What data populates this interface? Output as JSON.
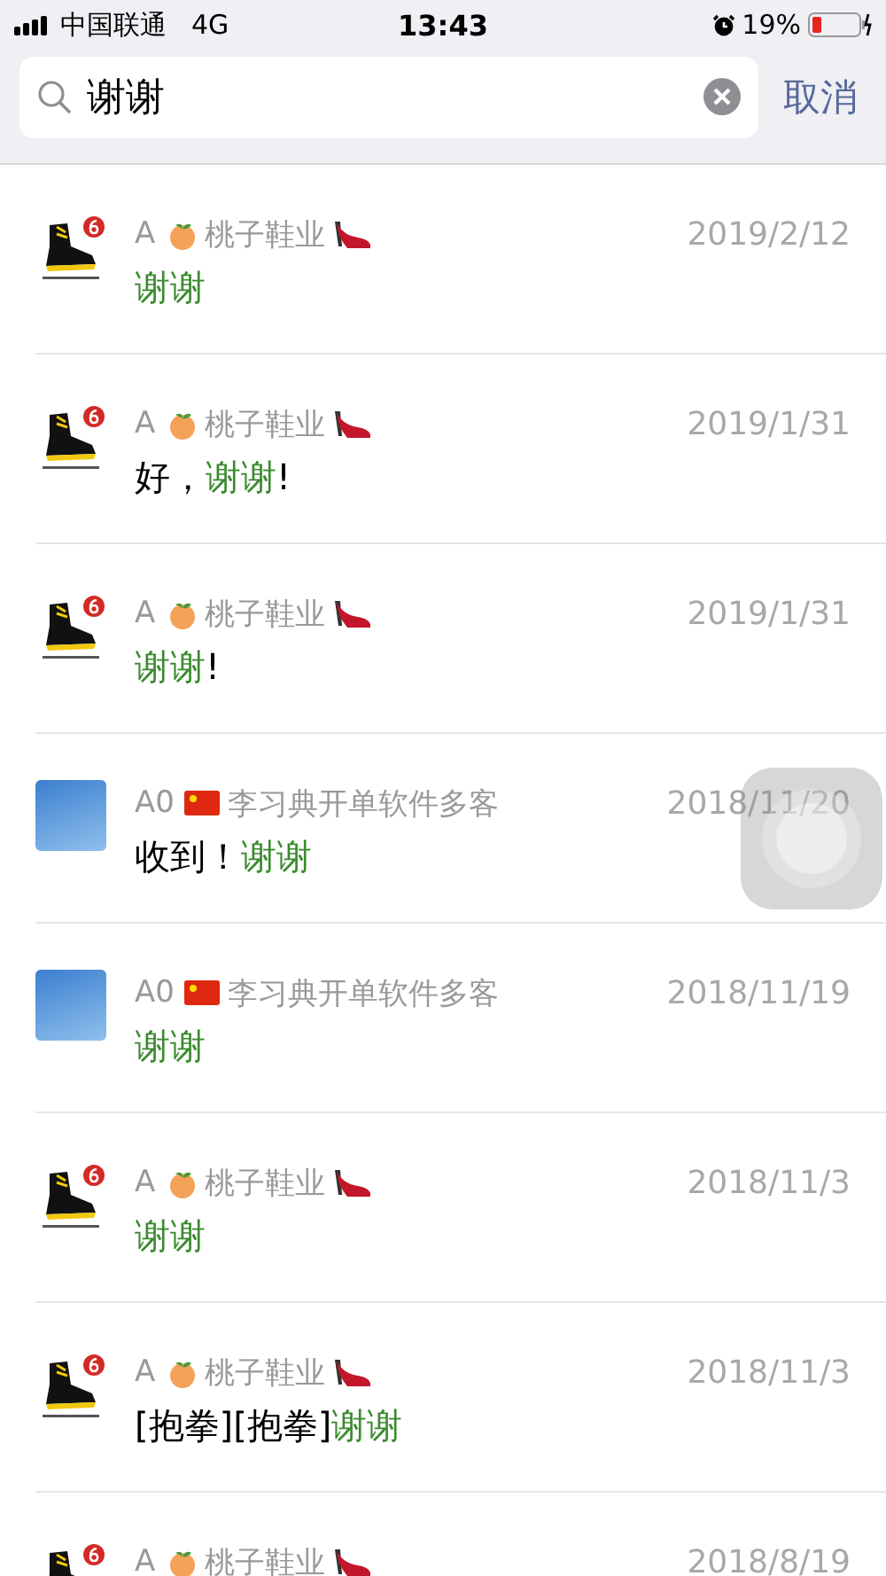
{
  "status_bar": {
    "carrier": "中国联通",
    "network": "4G",
    "time": "13:43",
    "battery_text": "19%"
  },
  "search": {
    "value": "谢谢",
    "cancel": "取消"
  },
  "results": [
    {
      "kind": "shoe",
      "prefix": "A",
      "name": "桃子鞋业",
      "date": "2019/2/12",
      "message": [
        {
          "text": "谢谢",
          "highlight": true
        }
      ]
    },
    {
      "kind": "shoe",
      "prefix": "A",
      "name": "桃子鞋业",
      "date": "2019/1/31",
      "message": [
        {
          "text": "好，",
          "highlight": false
        },
        {
          "text": "谢谢",
          "highlight": true
        },
        {
          "text": "!",
          "highlight": false
        }
      ]
    },
    {
      "kind": "shoe",
      "prefix": "A",
      "name": "桃子鞋业",
      "date": "2019/1/31",
      "message": [
        {
          "text": "谢谢",
          "highlight": true
        },
        {
          "text": "!",
          "highlight": false
        }
      ]
    },
    {
      "kind": "sky",
      "prefix": "A0",
      "name": "李习典开单软件多客",
      "date": "2018/11/20",
      "message": [
        {
          "text": "收到！",
          "highlight": false
        },
        {
          "text": "谢谢",
          "highlight": true
        }
      ]
    },
    {
      "kind": "sky",
      "prefix": "A0",
      "name": "李习典开单软件多客",
      "date": "2018/11/19",
      "message": [
        {
          "text": "谢谢",
          "highlight": true
        }
      ]
    },
    {
      "kind": "shoe",
      "prefix": "A",
      "name": "桃子鞋业",
      "date": "2018/11/3",
      "message": [
        {
          "text": "谢谢",
          "highlight": true
        }
      ]
    },
    {
      "kind": "shoe",
      "prefix": "A",
      "name": "桃子鞋业",
      "date": "2018/11/3",
      "message": [
        {
          "text": "[抱拳][抱拳]",
          "highlight": false
        },
        {
          "text": "谢谢",
          "highlight": true
        }
      ]
    },
    {
      "kind": "shoe",
      "prefix": "A",
      "name": "桃子鞋业",
      "date": "2018/8/19"
    }
  ]
}
